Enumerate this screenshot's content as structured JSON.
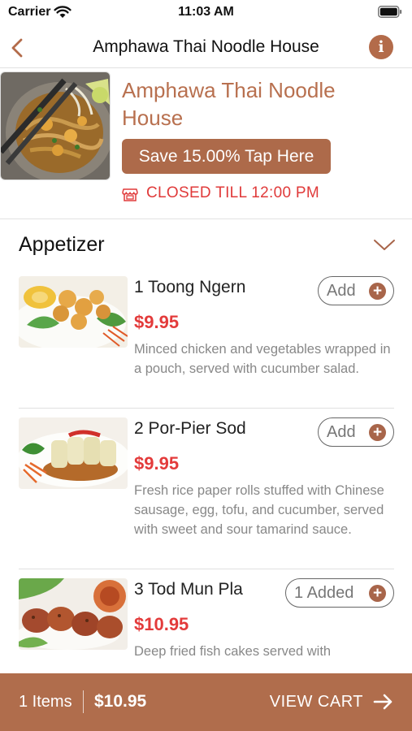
{
  "status_bar": {
    "carrier": "Carrier",
    "time": "11:03 AM"
  },
  "nav": {
    "title": "Amphawa Thai Noodle House"
  },
  "restaurant": {
    "name": "Amphawa Thai Noodle House",
    "promo_label": "Save 15.00% Tap Here",
    "status": "CLOSED TILL 12:00 PM"
  },
  "category": {
    "title": "Appetizer"
  },
  "menu_items": [
    {
      "name": "1 Toong Ngern",
      "price": "$9.95",
      "description": "Minced chicken and vegetables wrapped in a pouch, served with cucumber salad.",
      "button_label": "Add"
    },
    {
      "name": "2 Por-Pier Sod",
      "price": "$9.95",
      "description": "Fresh rice paper rolls stuffed with Chinese sausage, egg, tofu, and cucumber, served with sweet and sour tamarind sauce.",
      "button_label": "Add"
    },
    {
      "name": "3 Tod Mun Pla",
      "price": "$10.95",
      "description": "Deep fried fish cakes served with",
      "button_label": "1 Added"
    }
  ],
  "cart": {
    "count": "1 Items",
    "total": "$10.95",
    "action": "VIEW CART"
  },
  "colors": {
    "accent": "#b06d4c",
    "price": "#e33b3b",
    "closed": "#e03a3a",
    "title_brown": "#b8704f"
  },
  "icons": [
    "wifi-icon",
    "battery-icon",
    "back-arrow-icon",
    "info-icon",
    "store-icon",
    "chevron-down-icon",
    "plus-icon",
    "arrow-right-icon"
  ]
}
